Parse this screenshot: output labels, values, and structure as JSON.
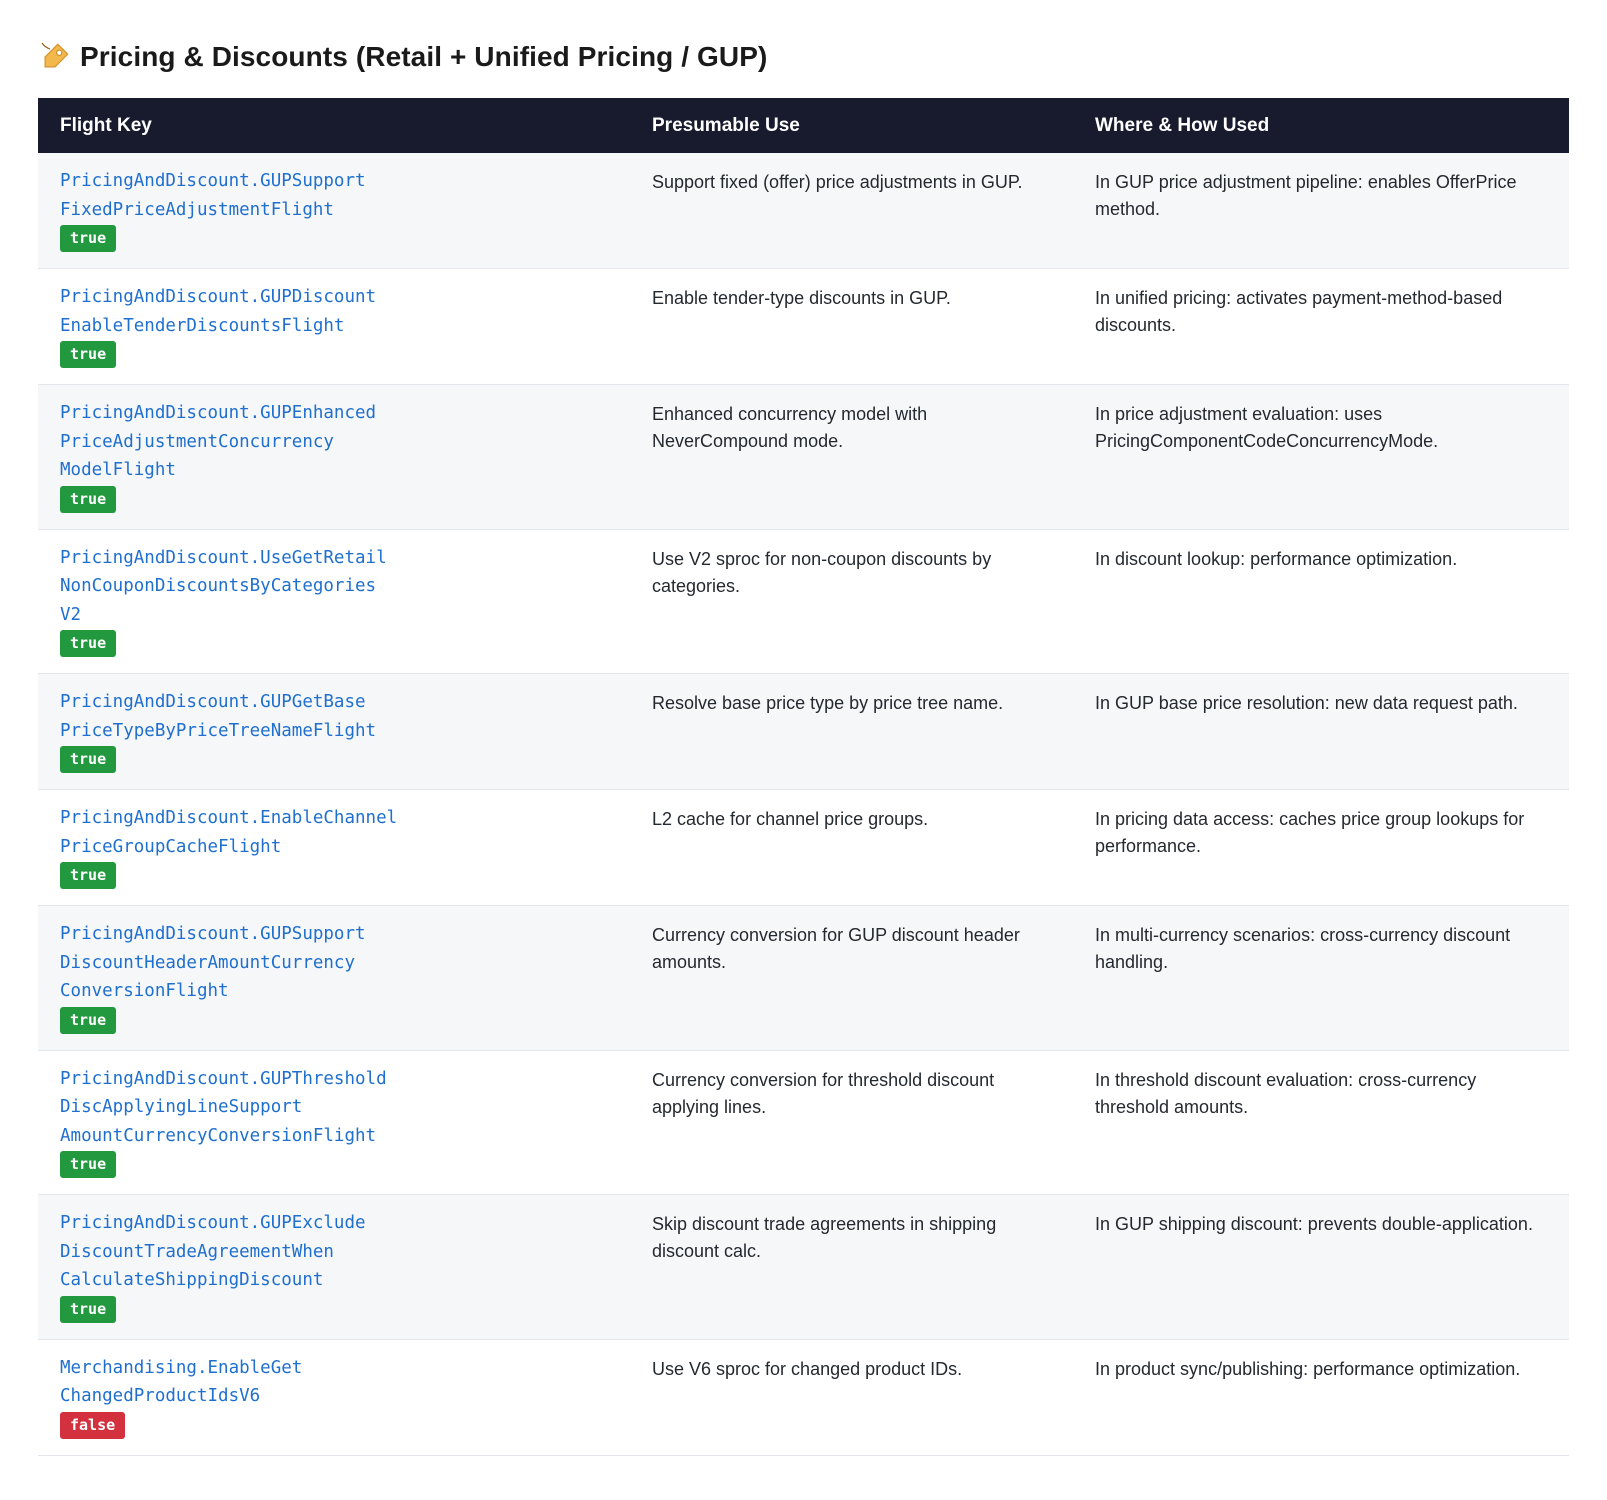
{
  "page": {
    "title": "Pricing & Discounts (Retail + Unified Pricing / GUP)",
    "title_icon": "label-tag-icon"
  },
  "table": {
    "headers": {
      "key": "Flight Key",
      "use": "Presumable Use",
      "where": "Where & How Used"
    },
    "rows": [
      {
        "key": "PricingAndDiscount.GUPSupport\nFixedPriceAdjustmentFlight",
        "value": "true",
        "use": "Support fixed (offer) price adjustments in GUP.",
        "where": "In GUP price adjustment pipeline: enables OfferPrice method."
      },
      {
        "key": "PricingAndDiscount.GUPDiscount\nEnableTenderDiscountsFlight",
        "value": "true",
        "use": "Enable tender-type discounts in GUP.",
        "where": "In unified pricing: activates payment-method-based discounts."
      },
      {
        "key": "PricingAndDiscount.GUPEnhanced\nPriceAdjustmentConcurrency\nModelFlight",
        "value": "true",
        "use": "Enhanced concurrency model with NeverCompound mode.",
        "where": "In price adjustment evaluation: uses PricingComponentCodeConcurrencyMode."
      },
      {
        "key": "PricingAndDiscount.UseGetRetail\nNonCouponDiscountsByCategories\nV2",
        "value": "true",
        "use": "Use V2 sproc for non-coupon discounts by categories.",
        "where": "In discount lookup: performance optimization."
      },
      {
        "key": "PricingAndDiscount.GUPGetBase\nPriceTypeByPriceTreeNameFlight",
        "value": "true",
        "use": "Resolve base price type by price tree name.",
        "where": "In GUP base price resolution: new data request path."
      },
      {
        "key": "PricingAndDiscount.EnableChannel\nPriceGroupCacheFlight",
        "value": "true",
        "use": "L2 cache for channel price groups.",
        "where": "In pricing data access: caches price group lookups for performance."
      },
      {
        "key": "PricingAndDiscount.GUPSupport\nDiscountHeaderAmountCurrency\nConversionFlight",
        "value": "true",
        "use": "Currency conversion for GUP discount header amounts.",
        "where": "In multi-currency scenarios: cross-currency discount handling."
      },
      {
        "key": "PricingAndDiscount.GUPThreshold\nDiscApplyingLineSupport\nAmountCurrencyConversionFlight",
        "value": "true",
        "use": "Currency conversion for threshold discount applying lines.",
        "where": "In threshold discount evaluation: cross-currency threshold amounts."
      },
      {
        "key": "PricingAndDiscount.GUPExclude\nDiscountTradeAgreementWhen\nCalculateShippingDiscount",
        "value": "true",
        "use": "Skip discount trade agreements in shipping discount calc.",
        "where": "In GUP shipping discount: prevents double-application."
      },
      {
        "key": "Merchandising.EnableGet\nChangedProductIdsV6",
        "value": "false",
        "use": "Use V6 sproc for changed product IDs.",
        "where": "In product sync/publishing: performance optimization."
      }
    ]
  },
  "colors": {
    "header_bg": "#181b2e",
    "key_text": "#1f6fcf",
    "badge_true": "#22993f",
    "badge_false": "#d3313d",
    "row_alt_bg": "#f6f7f9"
  }
}
